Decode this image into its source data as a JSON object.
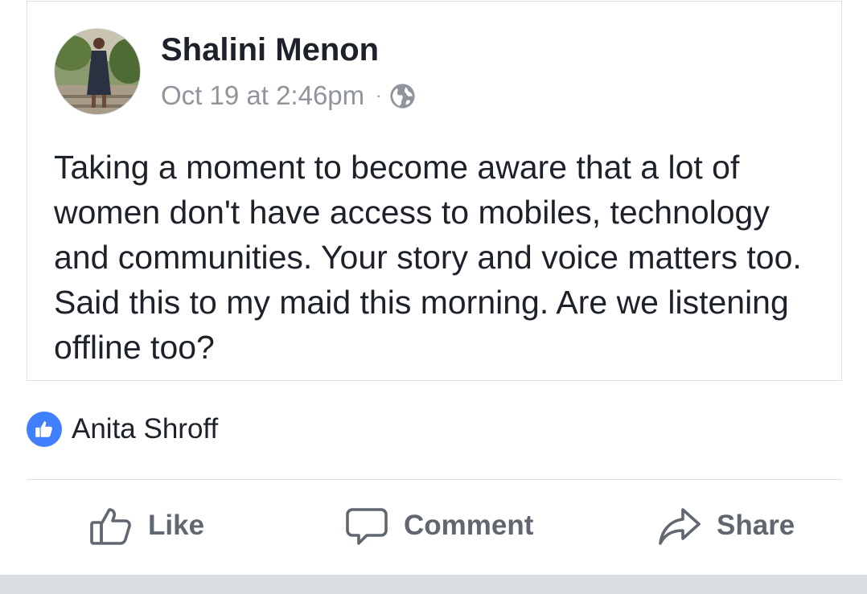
{
  "post": {
    "author_name": "Shalini Menon",
    "timestamp": "Oct 19 at 2:46pm",
    "separator": "·",
    "privacy_icon": "globe-icon",
    "text": "Taking a moment to become aware that a lot of women don't have access to mobiles, technology and communities. Your story and voice matters too. Said this to my maid this morning. Are we listening offline too?"
  },
  "reactions": {
    "icon": "thumbs-up-icon",
    "reactor_name": "Anita Shroff"
  },
  "actions": {
    "like_label": "Like",
    "comment_label": "Comment",
    "share_label": "Share"
  },
  "colors": {
    "action_gray": "#606770",
    "meta_gray": "#90949c",
    "like_blue": "#4080ff",
    "text": "#1d2129"
  }
}
